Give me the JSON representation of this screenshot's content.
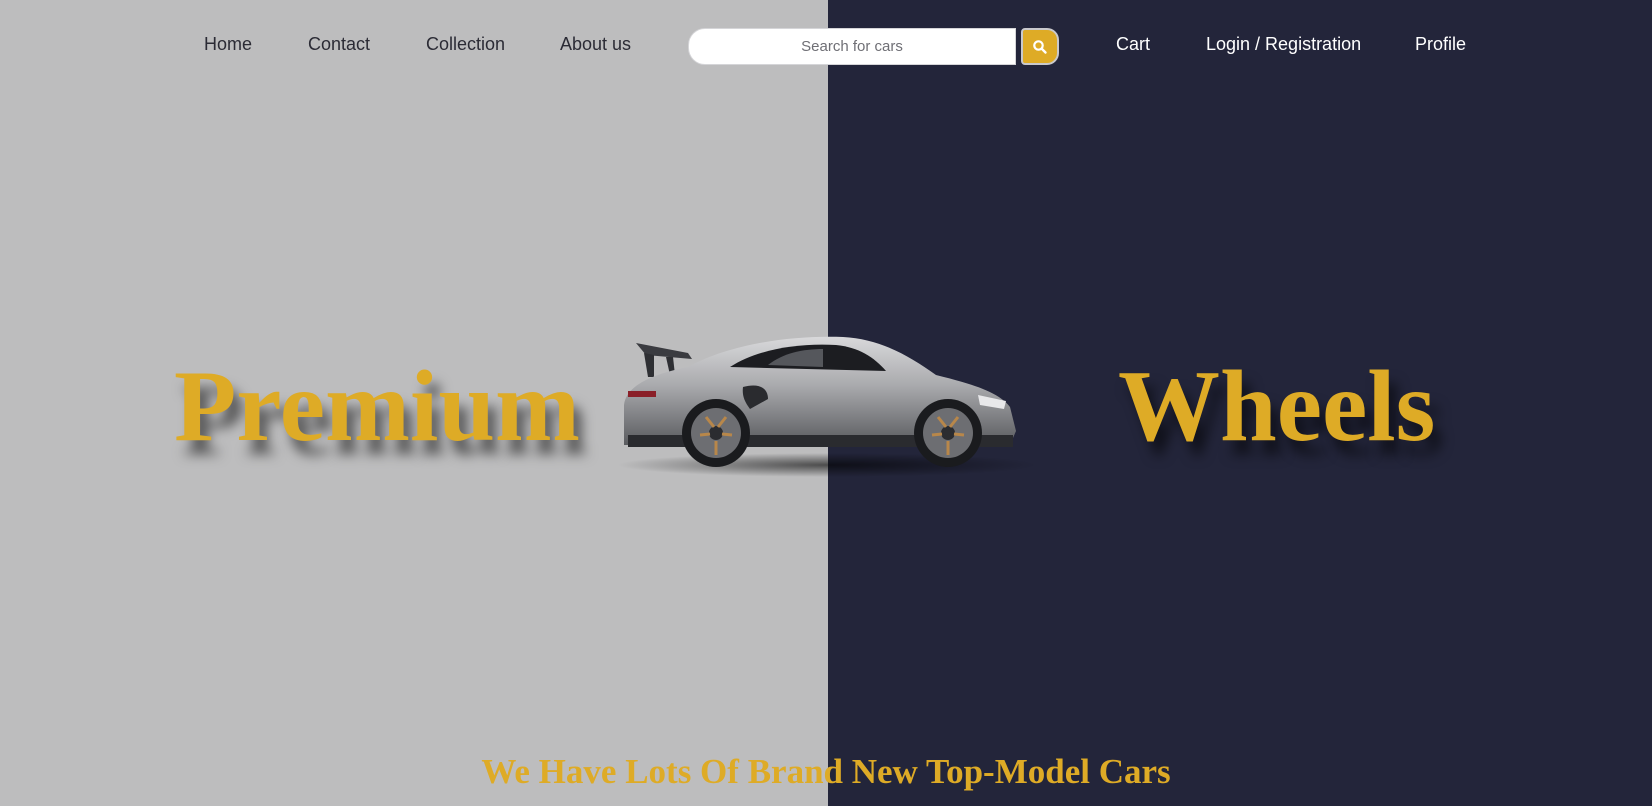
{
  "nav": {
    "left_links": [
      {
        "label": "Home"
      },
      {
        "label": "Contact"
      },
      {
        "label": "Collection"
      },
      {
        "label": "About us"
      }
    ],
    "right_links": [
      {
        "label": "Cart"
      },
      {
        "label": "Login / Registration"
      },
      {
        "label": "Profile"
      }
    ]
  },
  "search": {
    "placeholder": "Search for cars",
    "value": "",
    "button_icon": "search-icon"
  },
  "hero": {
    "left_word": "Premium",
    "right_word": "Wheels",
    "image": "sports-car"
  },
  "tagline": "We Have Lots Of Brand New Top-Model Cars",
  "colors": {
    "left_background": "#bdbdbe",
    "right_background": "#23253a",
    "accent": "#deab26",
    "nav_dark_text": "#2b2b35",
    "nav_light_text": "#ffffff"
  }
}
